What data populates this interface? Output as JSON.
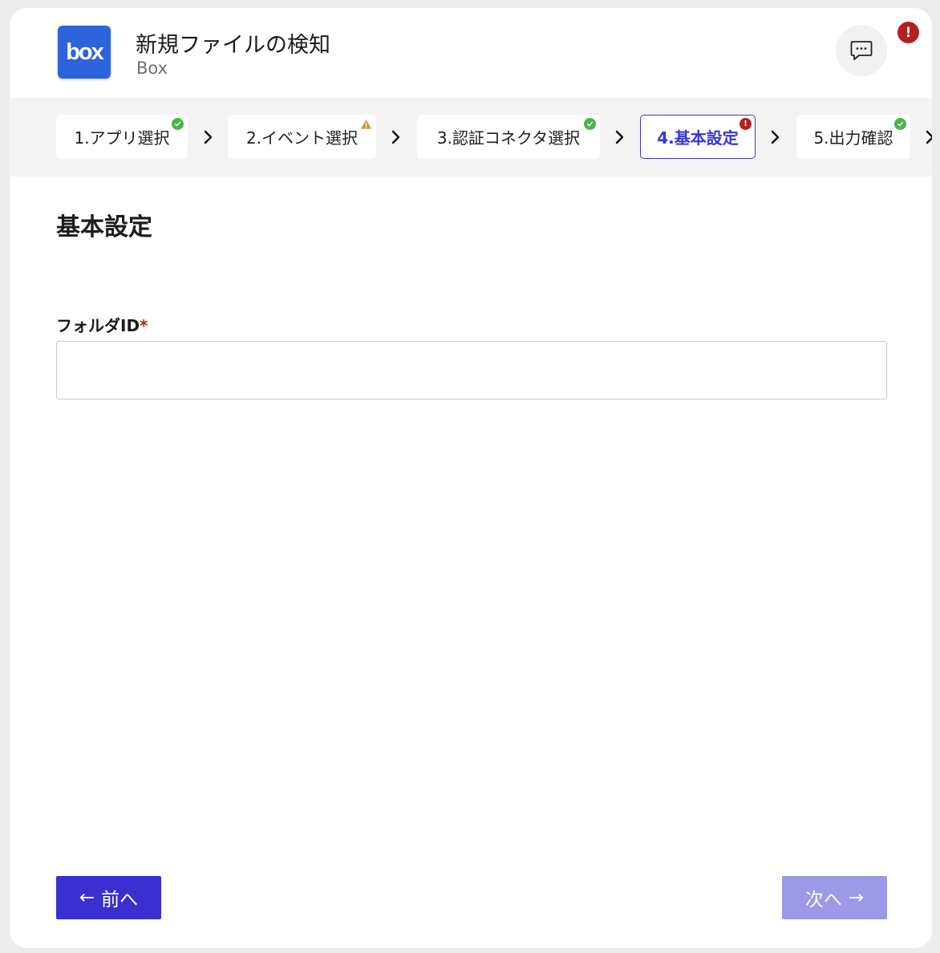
{
  "header": {
    "app_logo_text": "box",
    "title": "新規ファイルの検知",
    "subtitle": "Box",
    "comment_icon": "comment-dots-icon",
    "alert_badge": "!"
  },
  "steps": [
    {
      "label": "1.アプリ選択",
      "status": "complete",
      "icon": "check-circle-icon"
    },
    {
      "label": "2.イベント選択",
      "status": "warning",
      "icon": "warning-triangle-icon"
    },
    {
      "label": "3.認証コネクタ選択",
      "status": "complete",
      "icon": "check-circle-icon"
    },
    {
      "label": "4.基本設定",
      "status": "error",
      "icon": "error-circle-icon",
      "active": true
    },
    {
      "label": "5.出力確認",
      "status": "complete",
      "icon": "check-circle-icon"
    }
  ],
  "main": {
    "section_title": "基本設定",
    "folder_field": {
      "label": "フォルダID",
      "required_mark": "*",
      "value": "",
      "placeholder": ""
    }
  },
  "footer": {
    "prev_arrow": "←",
    "prev_label": "前へ",
    "next_label": "次へ",
    "next_arrow": "→"
  },
  "colors": {
    "primary": "#3a2fd1",
    "primary_disabled": "#9c99e6",
    "error": "#b3211e",
    "success": "#4bb54a",
    "warning": "#c99a2e",
    "box_brand": "#2d63db"
  }
}
